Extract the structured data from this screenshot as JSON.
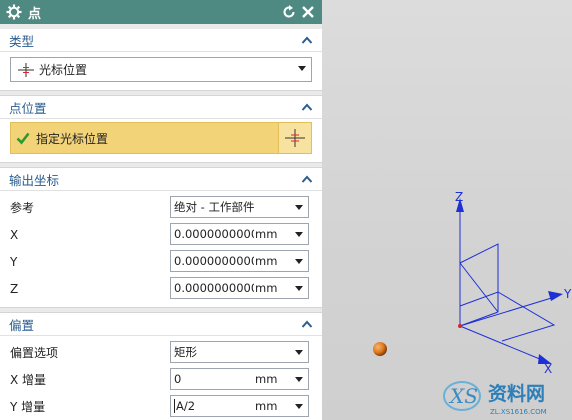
{
  "dialog": {
    "title": "点",
    "colors": {
      "titlebar": "#4f8a82",
      "section_heading": "#2a5d8f",
      "selection_highlight": "#f3d377"
    }
  },
  "type_section": {
    "heading": "类型",
    "selected": "光标位置",
    "icon": "cursor-crosshair-icon"
  },
  "point_location_section": {
    "heading": "点位置",
    "select_label": "指定光标位置",
    "status_icon": "green-check-icon"
  },
  "output_coords_section": {
    "heading": "输出坐标",
    "reference_label": "参考",
    "reference_value": "绝对 - 工作部件",
    "x_label": "X",
    "x_value": "0.0000000000",
    "y_label": "Y",
    "y_value": "0.0000000000",
    "z_label": "Z",
    "z_value": "0.0000000000",
    "unit": "mm"
  },
  "offset_section": {
    "heading": "偏置",
    "option_label": "偏置选项",
    "option_value": "矩形",
    "x_inc_label": "X 增量",
    "x_inc_value": "0",
    "y_inc_label": "Y 增量",
    "y_inc_value": "A/2",
    "unit": "mm"
  },
  "viewport": {
    "axis_labels": {
      "x": "X",
      "y": "Y",
      "z": "Z"
    },
    "triad_color": "#1e2fd6",
    "ball_color": "#e07b20"
  },
  "watermark": {
    "text": "资料网",
    "url": "ZL.XS1616.COM"
  }
}
